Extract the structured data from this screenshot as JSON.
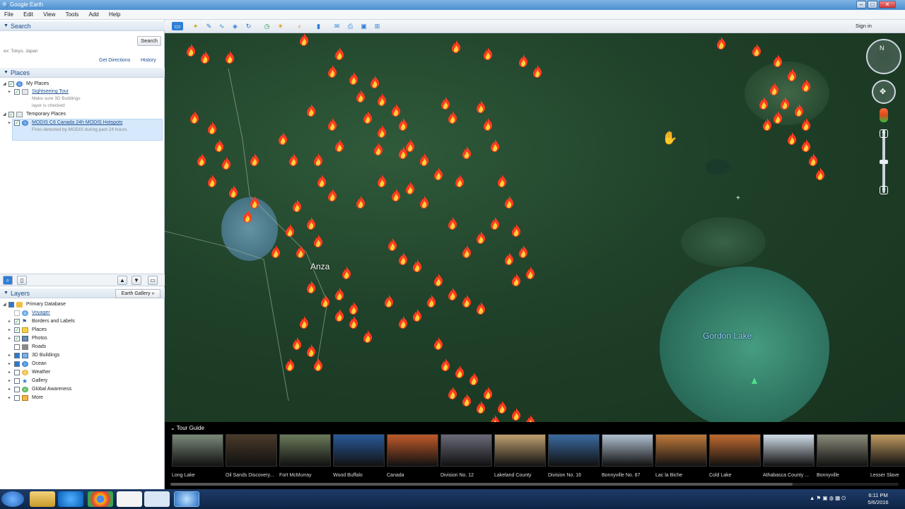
{
  "window": {
    "title": "Google Earth",
    "controls": [
      "–",
      "□",
      "✕"
    ]
  },
  "menu": [
    "File",
    "Edit",
    "View",
    "Tools",
    "Add",
    "Help"
  ],
  "search": {
    "header": "Search",
    "placeholder": "",
    "button": "Search",
    "hint": "ex: Tokyo, Japan",
    "get_directions": "Get Directions",
    "history": "History"
  },
  "places": {
    "header": "Places",
    "my_places": "My Places",
    "sightseeing": "Sightseeing Tour",
    "sightseeing_sub1": "Make sure 3D Buildings",
    "sightseeing_sub2": "layer is checked",
    "temporary": "Temporary Places",
    "modis": "MODIS C6 Canada 24h MODIS Hotspots",
    "modis_sub": "Fires detected by MODIS during past 24 hours."
  },
  "layers": {
    "header": "Layers",
    "gallery": "Earth Gallery »",
    "items": [
      "Primary Database",
      "Voyager",
      "Borders and Labels",
      "Places",
      "Photos",
      "Roads",
      "3D Buildings",
      "Ocean",
      "Weather",
      "Gallery",
      "Global Awareness",
      "More"
    ]
  },
  "toolbar": {
    "signin": "Sign in"
  },
  "map": {
    "label_town": "Anza",
    "label_lake": "Gordon Lake"
  },
  "tour_guide": {
    "title": "Tour Guide",
    "items": [
      "Long Lake",
      "Oil Sands Discovery...",
      "Fort McMurray",
      "Wood Buffalo",
      "Canada",
      "Division No. 12",
      "Lakeland County",
      "Division No. 16",
      "Bonnyville No. 87",
      "Lac la Biche",
      "Cold Lake",
      "Athabasca County ...",
      "Bonnyville",
      "Lesser Slave"
    ]
  },
  "clock": {
    "time": "6:11 PM",
    "date": "5/6/2016"
  }
}
